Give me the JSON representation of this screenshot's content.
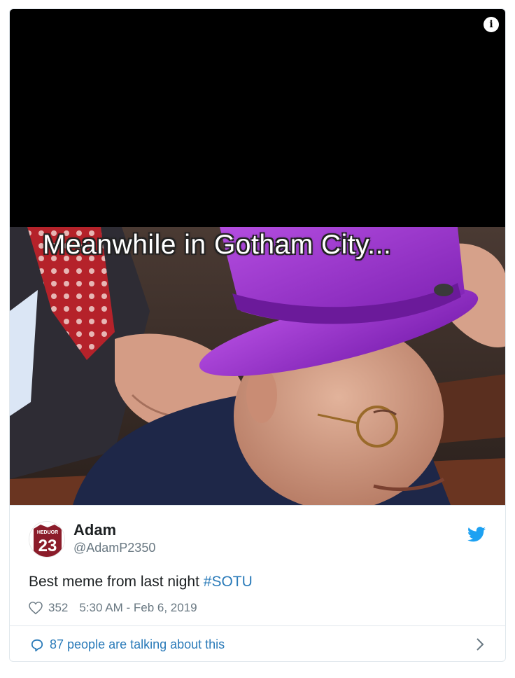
{
  "media": {
    "caption": "Meanwhile in Gotham City...",
    "info_icon": "info-icon"
  },
  "author": {
    "name": "Adam",
    "handle": "@AdamP2350",
    "avatar_jersey_name": "HEDUOR",
    "avatar_jersey_number": "23"
  },
  "tweet": {
    "text_prefix": "Best meme from last night ",
    "hashtag": "#SOTU",
    "likes": "352",
    "timestamp": "5:30 AM - Feb 6, 2019"
  },
  "footer": {
    "talking_text": "87 people are talking about this"
  },
  "colors": {
    "link": "#2b7bb9",
    "twitter_blue": "#1da1f2",
    "meta_gray": "#697882",
    "hat_purple": "#9b2ecf"
  }
}
